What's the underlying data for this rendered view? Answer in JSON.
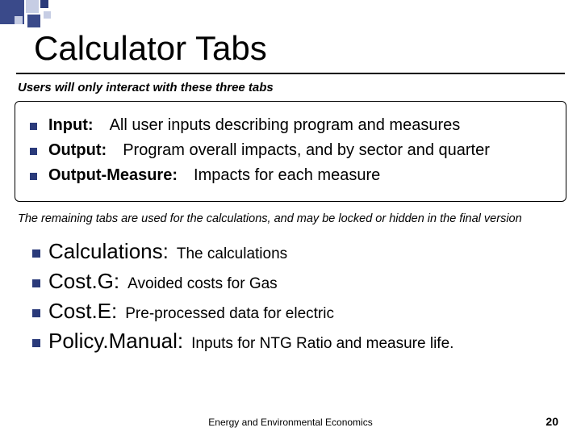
{
  "title": "Calculator Tabs",
  "intro_interactive": "Users will only interact with these three tabs",
  "interactive_tabs": [
    {
      "name": "Input:",
      "desc": "All user inputs describing program and measures"
    },
    {
      "name": "Output:",
      "desc": "Program overall impacts, and by sector and quarter"
    },
    {
      "name": "Output-Measure:",
      "desc": "Impacts for each measure"
    }
  ],
  "intro_hidden": "The remaining tabs are used for the calculations, and may be locked or hidden in the final version",
  "hidden_tabs": [
    {
      "name": "Calculations:",
      "desc": "The calculations"
    },
    {
      "name": "Cost.G:",
      "desc": "Avoided costs for Gas"
    },
    {
      "name": "Cost.E:",
      "desc": "Pre-processed data for electric"
    },
    {
      "name": "Policy.Manual:",
      "desc": "Inputs for NTG Ratio and measure life."
    }
  ],
  "footer": "Energy and Environmental Economics",
  "page": "20"
}
